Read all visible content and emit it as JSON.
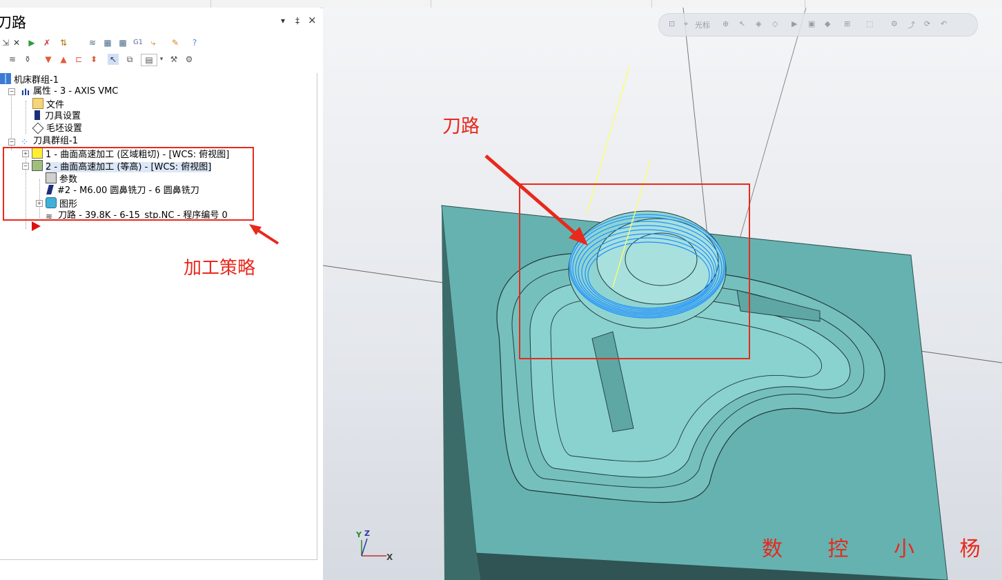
{
  "panel": {
    "title": "刀路",
    "controls": {
      "menu": "▾",
      "pin": "‡",
      "close": "×"
    }
  },
  "toolbar_row1": [
    "select-toolpath-icon",
    "deselect-icon",
    "regen-icon",
    "regen-dirty-icon",
    "toggle-toolpaths-icon",
    "backplot-icon",
    "verify-icon",
    "simulate-icon",
    "G1",
    "post-icon",
    "highfeed-icon",
    "help-icon"
  ],
  "toolbar_row2": [
    "toggle-display-icon",
    "wave-icon",
    "lock-icon",
    "move-down-icon",
    "move-up-icon",
    "insert-arrow-icon",
    "updown-icon",
    "select-cursor-icon",
    "copy-icon",
    "options-icon",
    "dropdown-icon",
    "toolpath-manager-icon",
    "machine-icon"
  ],
  "tree": {
    "machine_group": "机床群组-1",
    "properties": "属性 - 3 - AXIS VMC",
    "files": "文件",
    "tool_settings": "刀具设置",
    "stock_settings": "毛坯设置",
    "toolpath_group": "刀具群组-1",
    "op1": "1 - 曲面高速加工 (区域粗切) - [WCS: 俯视图]",
    "op2": "2 - 曲面高速加工 (等高) - [WCS: 俯视图]",
    "params": "参数",
    "tool": "#2 - M6.00 圆鼻铣刀 - 6 圆鼻铣刀",
    "geometry": "图形",
    "toolpath": "刀路 - 39.8K - 6-15_stp.NC - 程序编号 0"
  },
  "annotations": {
    "left_label": "加工策略",
    "right_label": "刀路",
    "color": "#e8291c"
  },
  "viewport": {
    "toolbar_cursor_label": "光标",
    "axis_labels": {
      "x": "X",
      "y": "Y",
      "z": "Z"
    },
    "watermark": "数 控 小 杨",
    "colors": {
      "part": "#66b2b0",
      "toolpath": "#1e8fff",
      "highlight": "#ffff66"
    }
  }
}
